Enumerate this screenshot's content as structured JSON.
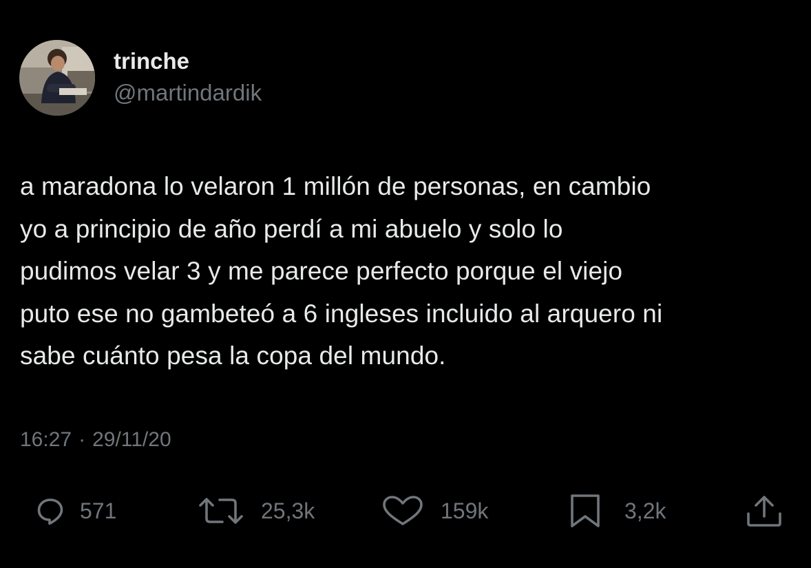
{
  "user": {
    "display_name": "trinche",
    "handle": "@martindardik",
    "avatar_icon": "profile-photo"
  },
  "tweet": {
    "text": "a maradona lo velaron 1 millón de personas, en cambio\nyo a principio de año perdí a mi abuelo y solo lo\npudimos velar 3 y me parece perfecto porque el viejo\nputo ese no gambeteó a 6 ingleses incluido al arquero ni\nsabe cuánto pesa la copa del mundo.",
    "time": "16:27",
    "separator": "·",
    "date": "29/11/20"
  },
  "actions": {
    "replies": {
      "icon": "reply-icon",
      "count": "571"
    },
    "retweets": {
      "icon": "retweet-icon",
      "count": "25,3k"
    },
    "likes": {
      "icon": "heart-icon",
      "count": "159k"
    },
    "bookmarks": {
      "icon": "bookmark-icon",
      "count": "3,2k"
    },
    "share": {
      "icon": "share-icon"
    }
  },
  "colors": {
    "background": "#000000",
    "primary_text": "#e7e9ea",
    "secondary_text": "#71767b",
    "icon": "#71767b"
  }
}
